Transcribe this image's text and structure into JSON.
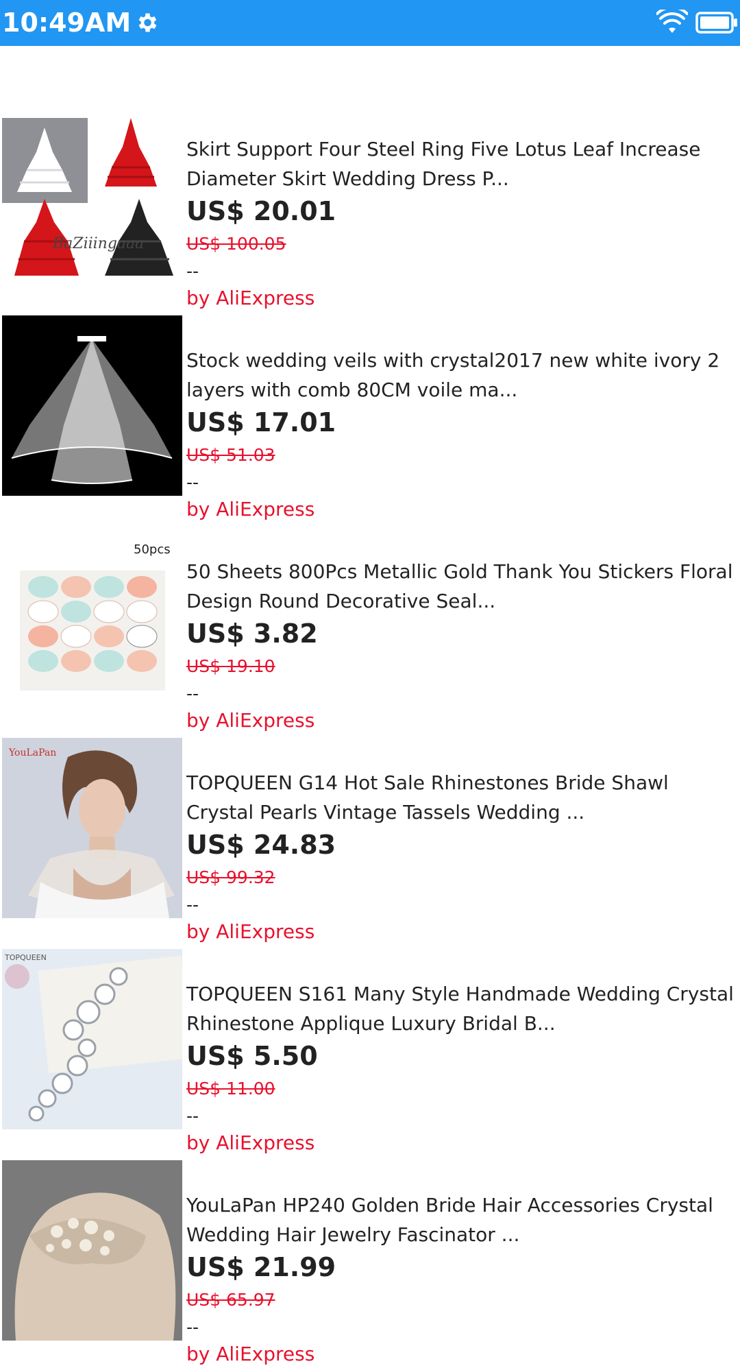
{
  "status_bar": {
    "time": "10:49AM",
    "color": "#2196f3"
  },
  "products": [
    {
      "title": "Skirt Support Four Steel Ring Five Lotus Leaf Increase Diameter Skirt Wedding Dress P...",
      "price": "US$ 20.01",
      "original_price": "US$ 100.05",
      "rating": "--",
      "seller": "by AliExpress",
      "image_text": "BaZiiingaaa"
    },
    {
      "title": "Stock wedding veils with crystal2017 new white ivory 2 layers with comb 80CM voile ma...",
      "price": "US$ 17.01",
      "original_price": "US$ 51.03",
      "rating": "--",
      "seller": "by AliExpress"
    },
    {
      "title": "50 Sheets 800Pcs Metallic Gold Thank You Stickers Floral Design Round Decorative Seal...",
      "price": "US$ 3.82",
      "original_price": "US$ 19.10",
      "rating": "--",
      "seller": "by AliExpress",
      "image_text": "50pcs"
    },
    {
      "title": "TOPQUEEN G14 Hot Sale Rhinestones Bride Shawl Crystal Pearls Vintage Tassels Wedding ...",
      "price": "US$ 24.83",
      "original_price": "US$ 99.32",
      "rating": "--",
      "seller": "by AliExpress",
      "image_text": "YouLaPan"
    },
    {
      "title": "TOPQUEEN S161 Many Style Handmade Wedding Crystal Rhinestone Applique Luxury Bridal B...",
      "price": "US$ 5.50",
      "original_price": "US$ 11.00",
      "rating": "--",
      "seller": "by AliExpress",
      "image_text": "TOPQUEEN"
    },
    {
      "title": "YouLaPan HP240 Golden Bride Hair Accessories Crystal Wedding Hair Jewelry Fascinator ...",
      "price": "US$ 21.99",
      "original_price": "US$ 65.97",
      "rating": "--",
      "seller": "by AliExpress"
    }
  ],
  "colors": {
    "price": "#222222",
    "original_price": "#e8112d",
    "seller": "#e8112d"
  }
}
